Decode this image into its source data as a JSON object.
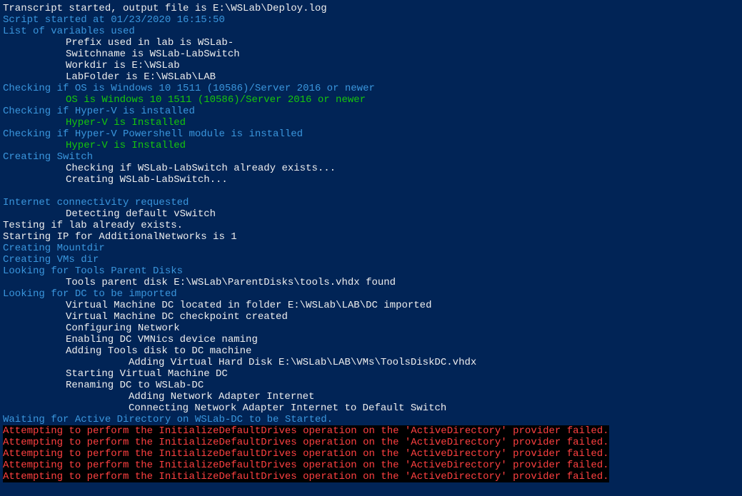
{
  "lines": [
    {
      "type": "white",
      "text": "Transcript started, output file is E:\\WSLab\\Deploy.log"
    },
    {
      "type": "cyan",
      "text": "Script started at 01/23/2020 16:15:50"
    },
    {
      "type": "cyan",
      "text": "List of variables used"
    },
    {
      "type": "white indent1",
      "text": "Prefix used in lab is WSLab-"
    },
    {
      "type": "white indent1",
      "text": "Switchname is WSLab-LabSwitch"
    },
    {
      "type": "white indent1",
      "text": "Workdir is E:\\WSLab"
    },
    {
      "type": "white indent1",
      "text": "LabFolder is E:\\WSLab\\LAB"
    },
    {
      "type": "cyan",
      "text": "Checking if OS is Windows 10 1511 (10586)/Server 2016 or newer"
    },
    {
      "type": "green indent1",
      "text": "OS is Windows 10 1511 (10586)/Server 2016 or newer"
    },
    {
      "type": "cyan",
      "text": "Checking if Hyper-V is installed"
    },
    {
      "type": "green indent1",
      "text": "Hyper-V is Installed"
    },
    {
      "type": "cyan",
      "text": "Checking if Hyper-V Powershell module is installed"
    },
    {
      "type": "green indent1",
      "text": "Hyper-V is Installed"
    },
    {
      "type": "cyan",
      "text": "Creating Switch"
    },
    {
      "type": "white indent1",
      "text": "Checking if WSLab-LabSwitch already exists..."
    },
    {
      "type": "white indent1",
      "text": "Creating WSLab-LabSwitch..."
    },
    {
      "type": "blank",
      "text": " "
    },
    {
      "type": "cyan",
      "text": "Internet connectivity requested"
    },
    {
      "type": "white indent1",
      "text": "Detecting default vSwitch"
    },
    {
      "type": "white",
      "text": "Testing if lab already exists."
    },
    {
      "type": "white",
      "text": "Starting IP for AdditionalNetworks is 1"
    },
    {
      "type": "cyan",
      "text": "Creating Mountdir"
    },
    {
      "type": "cyan",
      "text": "Creating VMs dir"
    },
    {
      "type": "cyan",
      "text": "Looking for Tools Parent Disks"
    },
    {
      "type": "white indent1",
      "text": "Tools parent disk E:\\WSLab\\ParentDisks\\tools.vhdx found"
    },
    {
      "type": "cyan",
      "text": "Looking for DC to be imported"
    },
    {
      "type": "white indent1",
      "text": "Virtual Machine DC located in folder E:\\WSLab\\LAB\\DC imported"
    },
    {
      "type": "white indent1",
      "text": "Virtual Machine DC checkpoint created"
    },
    {
      "type": "white indent1",
      "text": "Configuring Network"
    },
    {
      "type": "white indent1",
      "text": "Enabling DC VMNics device naming"
    },
    {
      "type": "white indent1",
      "text": "Adding Tools disk to DC machine"
    },
    {
      "type": "white indent2",
      "text": "Adding Virtual Hard Disk E:\\WSLab\\LAB\\VMs\\ToolsDiskDC.vhdx"
    },
    {
      "type": "white indent1",
      "text": "Starting Virtual Machine DC"
    },
    {
      "type": "white indent1",
      "text": "Renaming DC to WSLab-DC"
    },
    {
      "type": "white indent2",
      "text": "Adding Network Adapter Internet"
    },
    {
      "type": "white indent2",
      "text": "Connecting Network Adapter Internet to Default Switch"
    },
    {
      "type": "cyan",
      "text": "Waiting for Active Directory on WSLab-DC to be Started."
    },
    {
      "type": "error",
      "text": "Attempting to perform the InitializeDefaultDrives operation on the 'ActiveDirectory' provider failed."
    },
    {
      "type": "error",
      "text": "Attempting to perform the InitializeDefaultDrives operation on the 'ActiveDirectory' provider failed."
    },
    {
      "type": "error",
      "text": "Attempting to perform the InitializeDefaultDrives operation on the 'ActiveDirectory' provider failed."
    },
    {
      "type": "error",
      "text": "Attempting to perform the InitializeDefaultDrives operation on the 'ActiveDirectory' provider failed."
    },
    {
      "type": "error",
      "text": "Attempting to perform the InitializeDefaultDrives operation on the 'ActiveDirectory' provider failed."
    }
  ]
}
